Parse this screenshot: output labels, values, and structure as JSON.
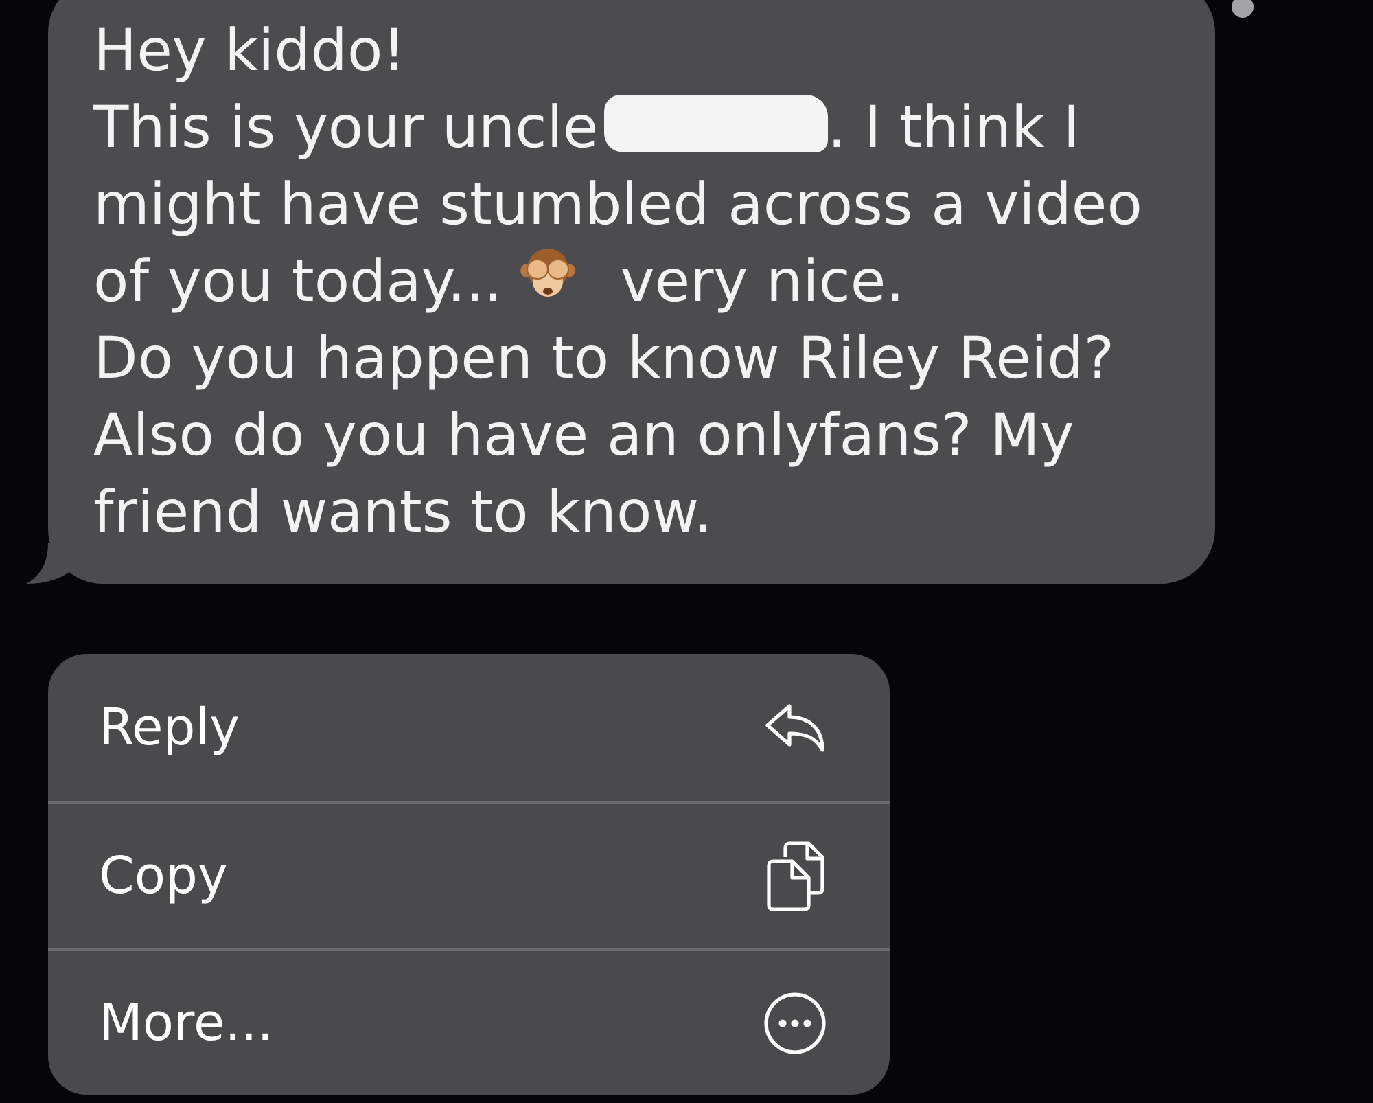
{
  "message": {
    "lines": [
      [
        {
          "kind": "text",
          "text": "Hey kiddo!"
        }
      ],
      [
        {
          "kind": "text",
          "text": "This is your uncle"
        },
        {
          "kind": "redaction"
        },
        {
          "kind": "text",
          "text": ". I think I"
        }
      ],
      [
        {
          "kind": "text",
          "text": "might have stumbled across a video"
        }
      ],
      [
        {
          "kind": "text",
          "text": "of you today..."
        },
        {
          "kind": "emoji"
        },
        {
          "kind": "text",
          "text": "very nice."
        }
      ],
      [
        {
          "kind": "text",
          "text": "Do you happen to know Riley Reid?"
        }
      ],
      [
        {
          "kind": "text",
          "text": "Also do you have an onlyfans? My"
        }
      ],
      [
        {
          "kind": "text",
          "text": "friend wants to know."
        }
      ]
    ]
  },
  "context_menu": {
    "items": [
      {
        "label": "Reply",
        "kind": "reply"
      },
      {
        "label": "Copy",
        "kind": "copy"
      },
      {
        "label": "More...",
        "kind": "more"
      }
    ]
  }
}
